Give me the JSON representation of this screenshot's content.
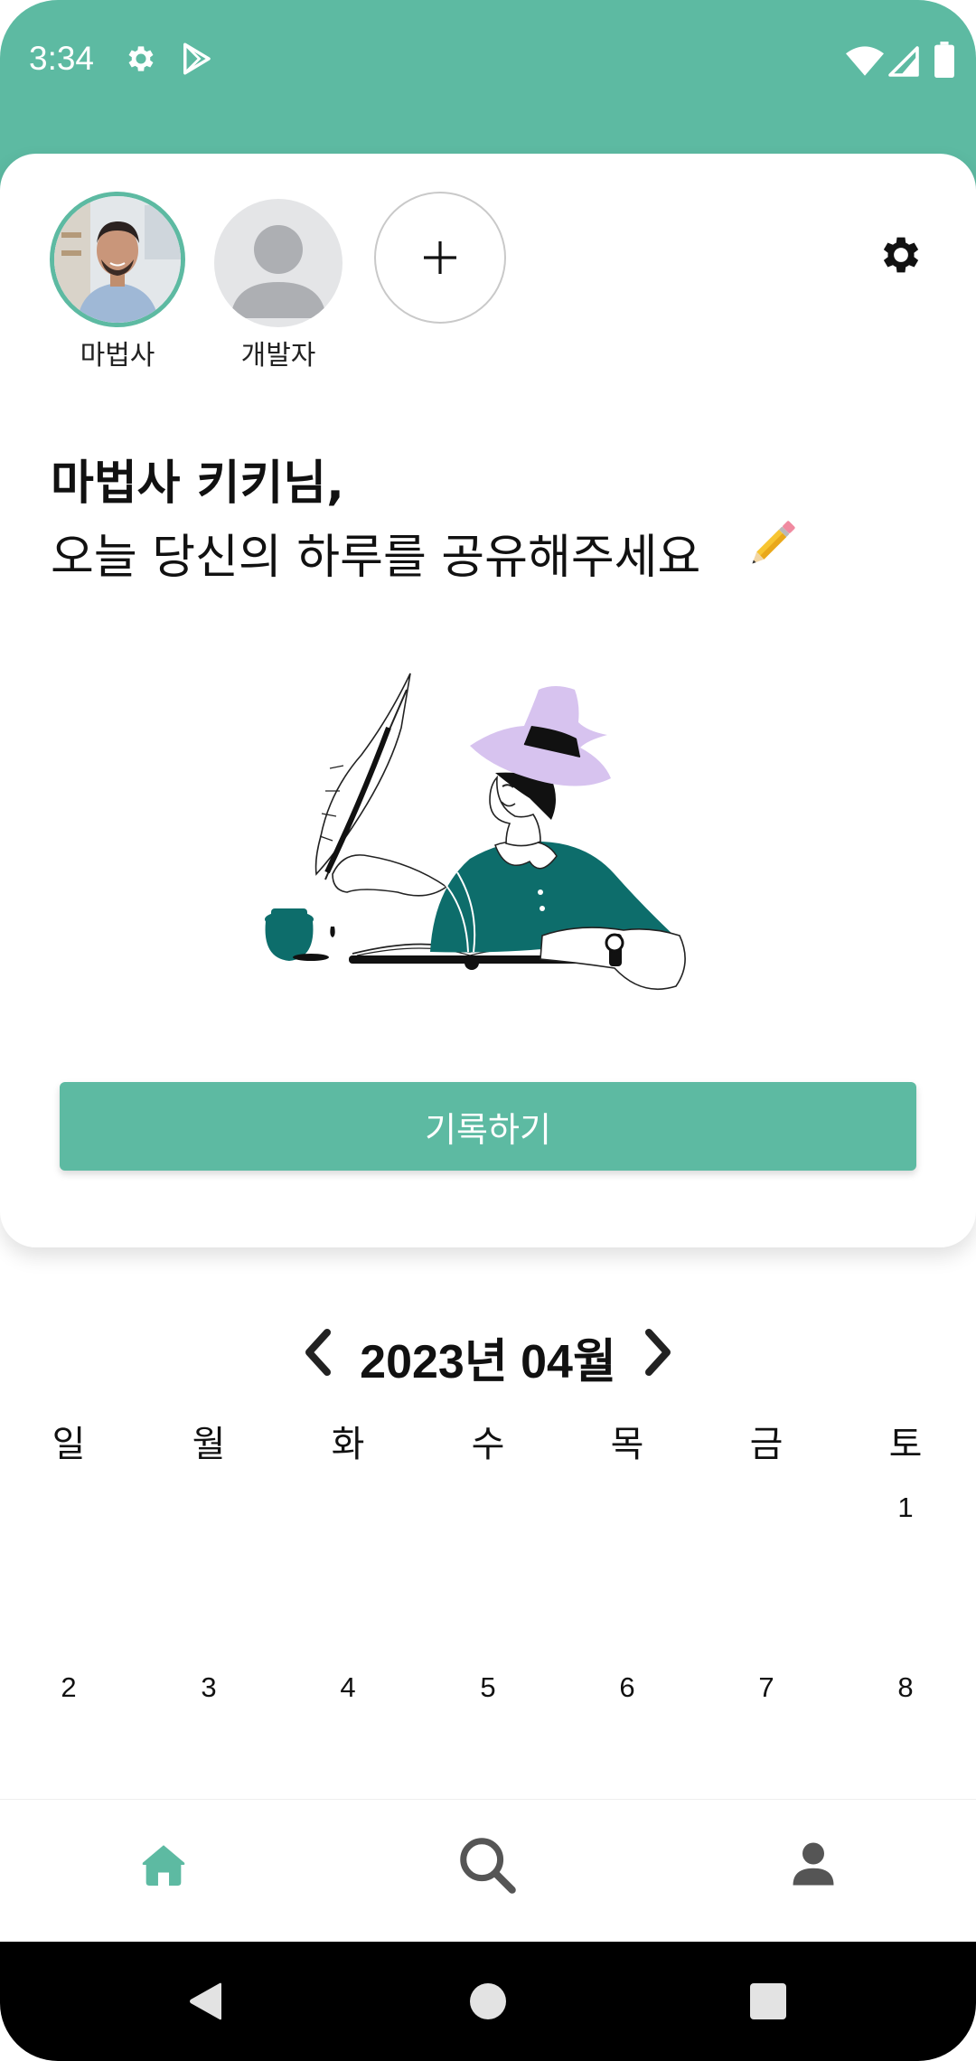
{
  "status_bar": {
    "time": "3:34",
    "icons": [
      "gear-icon",
      "play-store-icon",
      "wifi-icon",
      "signal-icon",
      "battery-icon"
    ]
  },
  "profiles": [
    {
      "name": "마법사",
      "selected": true,
      "avatar": "photo"
    },
    {
      "name": "개발자",
      "selected": false,
      "avatar": "placeholder-person-icon"
    },
    {
      "name": "",
      "add_icon": "plus-icon"
    }
  ],
  "greeting": {
    "title": "마법사 키키님,",
    "subtitle": "오늘 당신의 하루를 공유해주세요",
    "emoji": "pencil-emoji"
  },
  "record_button": "기록하기",
  "calendar": {
    "month_label": "2023년 04월",
    "weekdays": [
      "일",
      "월",
      "화",
      "수",
      "목",
      "금",
      "토"
    ],
    "rows": [
      [
        "",
        "",
        "",
        "",
        "",
        "",
        "1"
      ],
      [
        "2",
        "3",
        "4",
        "5",
        "6",
        "7",
        "8"
      ]
    ]
  },
  "bottom_nav": {
    "items": [
      "home-icon",
      "search-icon",
      "profile-icon"
    ],
    "active": "home-icon"
  },
  "colors": {
    "accent": "#5dbaa2",
    "dark_teal": "#0d6d6b",
    "hat_purple": "#d7c3ef",
    "nav_inactive": "#555555"
  }
}
